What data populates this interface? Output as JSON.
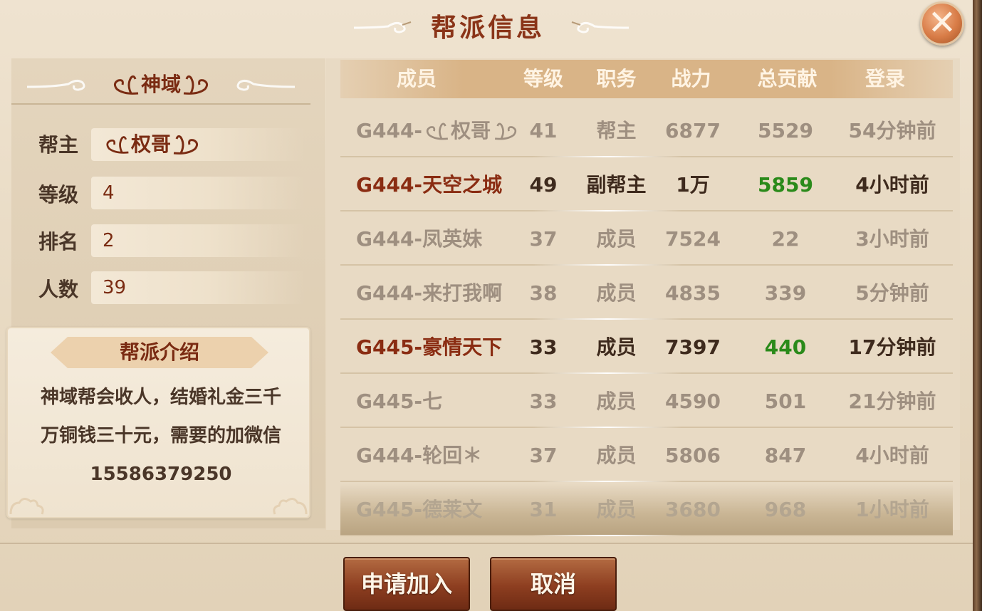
{
  "dialog": {
    "title": "帮派信息",
    "close_label": "✕"
  },
  "guild": {
    "name": "神域",
    "fields": [
      {
        "label": "帮主",
        "value": "权哥"
      },
      {
        "label": "等级",
        "value": "4"
      },
      {
        "label": "排名",
        "value": "2"
      },
      {
        "label": "人数",
        "value": "39"
      }
    ],
    "intro_title": "帮派介绍",
    "intro_lines": [
      "神域帮会收人，结婚礼金三千",
      "万铜钱三十元，需要的加微信",
      "15586379250"
    ]
  },
  "table": {
    "headers": [
      "成员",
      "等级",
      "职务",
      "战力",
      "总贡献",
      "登录"
    ],
    "rows": [
      {
        "prefix": "G444-",
        "name": "权哥",
        "level": "41",
        "role": "帮主",
        "power": "6877",
        "contribution": "5529",
        "login": "54分钟前",
        "highlight": false
      },
      {
        "prefix": "G444-",
        "name": "天空之城",
        "level": "49",
        "role": "副帮主",
        "power": "1万",
        "contribution": "5859",
        "login": "4小时前",
        "highlight": true
      },
      {
        "prefix": "G444-",
        "name": "凤英妹",
        "level": "37",
        "role": "成员",
        "power": "7524",
        "contribution": "22",
        "login": "3小时前",
        "highlight": false
      },
      {
        "prefix": "G444-",
        "name": "来打我啊",
        "level": "38",
        "role": "成员",
        "power": "4835",
        "contribution": "339",
        "login": "5分钟前",
        "highlight": false
      },
      {
        "prefix": "G445-",
        "name": "豪情天下",
        "level": "33",
        "role": "成员",
        "power": "7397",
        "contribution": "440",
        "login": "17分钟前",
        "highlight": true
      },
      {
        "prefix": "G445-",
        "name": "七",
        "level": "33",
        "role": "成员",
        "power": "4590",
        "contribution": "501",
        "login": "21分钟前",
        "highlight": false
      },
      {
        "prefix": "G444-",
        "name": "轮回＊",
        "level": "37",
        "role": "成员",
        "power": "5806",
        "contribution": "847",
        "login": "4小时前",
        "highlight": false
      },
      {
        "prefix": "G445-",
        "name": "德莱文",
        "level": "31",
        "role": "成员",
        "power": "3680",
        "contribution": "968",
        "login": "1小时前",
        "highlight": false
      }
    ]
  },
  "buttons": {
    "apply": "申请加入",
    "cancel": "取消"
  },
  "colors": {
    "title": "#8a3418",
    "highlight_name": "#8a2c12",
    "contribution_green": "#2a8a1a",
    "button": "#8d3e20"
  }
}
